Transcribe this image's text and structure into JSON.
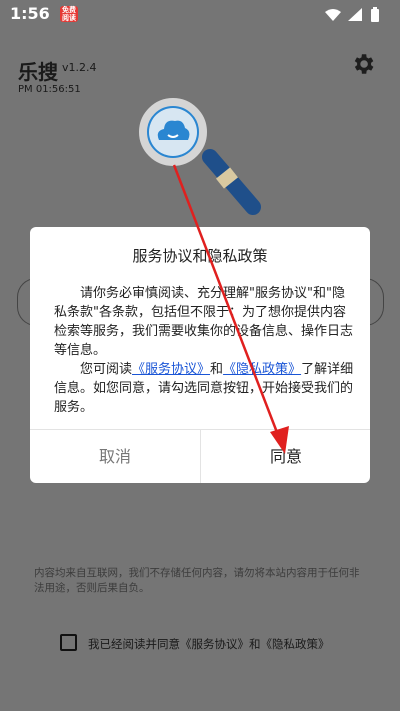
{
  "status_bar": {
    "time": "1:56",
    "notification_text": "免费阅读",
    "icons": [
      "wifi-icon",
      "signal-icon",
      "battery-icon"
    ]
  },
  "header": {
    "title": "乐搜",
    "version": "v1.2.4",
    "clock": "PM 01:56:51"
  },
  "background": {
    "disclaimer": "内容均来自互联网，我们不存储任何内容，请勿将本站内容用于任何非法用途，否则后果自负。",
    "agree_prefix": "我已经阅读并同意《服务协议》和《隐私政策》"
  },
  "dialog": {
    "title": "服务协议和隐私政策",
    "para1": "请你务必审慎阅读、充分理解\"服务协议\"和\"隐私条款\"各条款，包括但不限于：为了想你提供内容检索等服务，我们需要收集你的设备信息、操作日志等信息。",
    "para2_pre": "您可阅读",
    "link_service": "《服务协议》",
    "and": "和",
    "link_privacy": "《隐私政策》",
    "para2_post": "了解详细信息。如您同意，请勾选同意按钮，开始接受我们的服务。",
    "cancel_label": "取消",
    "confirm_label": "同意"
  },
  "colors": {
    "overlay": "#757575",
    "dialog_bg": "#ffffff",
    "link": "#1a55d6",
    "annotation_arrow": "#e0201f",
    "magnifier_blue": "#1f6fb5"
  }
}
